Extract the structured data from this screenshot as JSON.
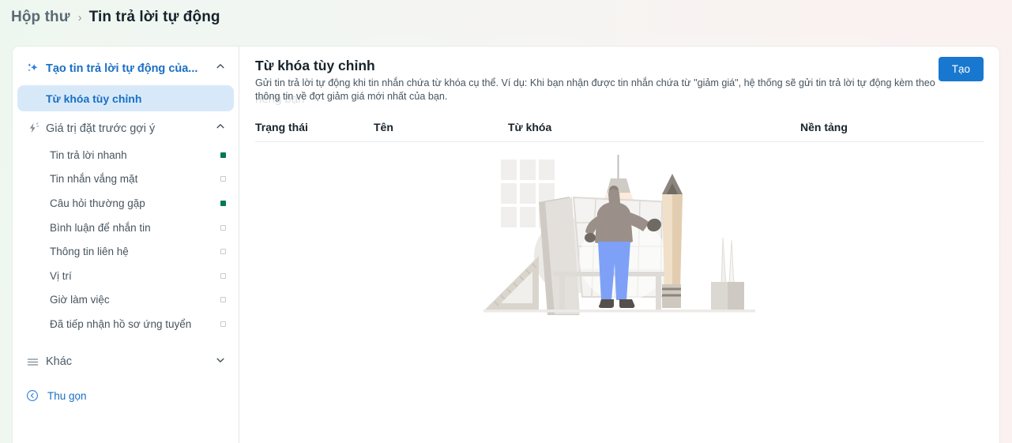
{
  "breadcrumb": {
    "parent": "Hộp thư",
    "separator": "›",
    "current": "Tin trả lời tự động"
  },
  "sidebar": {
    "groups": [
      {
        "icon": "sparkle-icon",
        "label": "Tạo tin trả lời tự động của...",
        "chevron": "chevron-up-icon",
        "expanded": true
      },
      {
        "icon": "lightning-icon",
        "label": "Giá trị đặt trước gợi ý",
        "chevron": "chevron-up-icon",
        "expanded": true
      },
      {
        "icon": "hamburger-icon",
        "label": "Khác",
        "chevron": "chevron-down-icon",
        "expanded": false
      }
    ],
    "selected_item": "Từ khóa tùy chỉnh",
    "items": [
      {
        "label": "Tin trả lời nhanh",
        "status": "on"
      },
      {
        "label": "Tin nhắn vắng mặt",
        "status": "off"
      },
      {
        "label": "Câu hỏi thường gặp",
        "status": "on"
      },
      {
        "label": "Bình luận để nhắn tin",
        "status": "off"
      },
      {
        "label": "Thông tin liên hệ",
        "status": "off"
      },
      {
        "label": "Vị trí",
        "status": "off"
      },
      {
        "label": "Giờ làm việc",
        "status": "off"
      },
      {
        "label": "Đã tiếp nhận hồ sơ ứng tuyển",
        "status": "off"
      }
    ],
    "collapse": {
      "icon": "collapse-left-icon",
      "label": "Thu gọn"
    }
  },
  "main": {
    "ghost_title": "riêng bạn",
    "title": "Từ khóa tùy chỉnh",
    "description": "Gửi tin trả lời tự động khi tin nhắn chứa từ khóa cụ thể. Ví dụ: Khi bạn nhận được tin nhắn chứa từ \"giảm giá\", hệ thống sẽ gửi tin trả lời tự động kèm theo thông tin về đợt giảm giá mới nhất của bạn.",
    "create_button": "Tạo",
    "table_headers": [
      "Trạng thái",
      "Tên",
      "Từ khóa",
      "Nền tảng"
    ],
    "rows": [],
    "empty_illustration": "drafting-desk-illustration"
  },
  "colors": {
    "accent_blue": "#1878cf",
    "selected_bg": "#d7e9f9",
    "status_on": "#017a4f",
    "text_dark": "#17232b",
    "text_muted": "#46545f"
  }
}
